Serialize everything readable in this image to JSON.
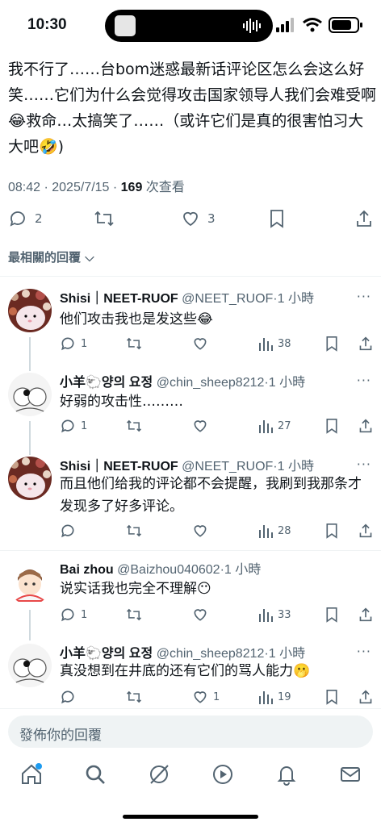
{
  "status_bar": {
    "time": "10:30"
  },
  "tweet": {
    "text": "我不行了……台bom迷惑最新话评论区怎么会这么好笑……它们为什么会觉得攻击国家领导人我们会难受啊😂救命…太搞笑了……（或许它们是真的很害怕习大大吧🤣)",
    "timestamp": "08:42 · 2025/7/15 · ",
    "views_count": "169",
    "views_label": " 次查看",
    "replies": "2",
    "likes": "3"
  },
  "sort_label": "最相關的回覆",
  "replies": [
    {
      "name": "Shisi｜NEET-RUOF",
      "handle": "@NEET_RUOF",
      "time": "·1 小時",
      "text": "他们攻击我也是发这些😂",
      "reply_count": "1",
      "retweets": "",
      "likes": "",
      "views": "38"
    },
    {
      "name": "小羊🐑양의 요정",
      "handle": "@chin_sheep8212",
      "time": "·1 小時",
      "text": "好弱的攻击性………",
      "reply_count": "1",
      "retweets": "",
      "likes": "",
      "views": "27"
    },
    {
      "name": "Shisi｜NEET-RUOF",
      "handle": "@NEET_RUOF",
      "time": "·1 小時",
      "text": "而且他们给我的评论都不会提醒，我刷到我那条才发现多了好多评论。",
      "reply_count": "",
      "retweets": "",
      "likes": "",
      "views": "28"
    },
    {
      "name": "Bai zhou",
      "handle": "@Baizhou040602",
      "time": "·1 小時",
      "text": "说实话我也完全不理解😶",
      "reply_count": "1",
      "retweets": "",
      "likes": "",
      "views": "33"
    },
    {
      "name": "小羊🐑양의 요정",
      "handle": "@chin_sheep8212",
      "time": "·1 小時",
      "text": "真没想到在井底的还有它们的骂人能力🫢",
      "reply_count": "",
      "retweets": "",
      "likes": "1",
      "views": "19"
    }
  ],
  "composer": {
    "placeholder": "發佈你的回覆"
  },
  "tabs": [
    "home-icon",
    "search-icon",
    "grok-icon",
    "video-icon",
    "notifications-icon",
    "messages-icon"
  ],
  "colors": {
    "accent": "#1d9bf0",
    "secondary_text": "#536471",
    "divider": "#eff3f4"
  }
}
